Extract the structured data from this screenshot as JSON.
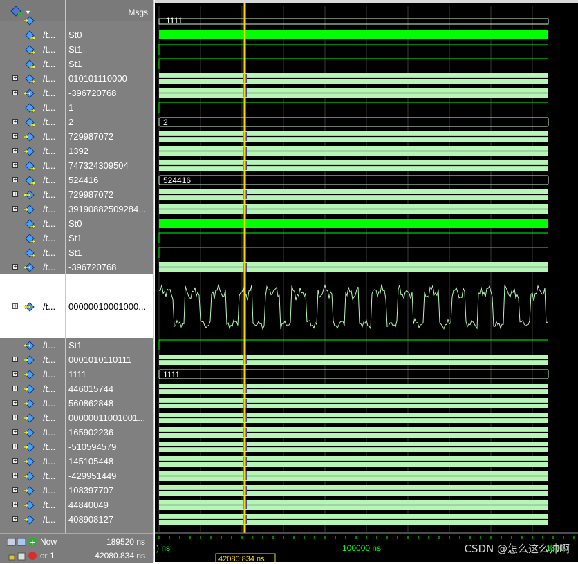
{
  "header": {
    "msgs_label": "Msgs",
    "top_icon": "wave-window-icon"
  },
  "signals": [
    {
      "name": "/t...",
      "value": "St0",
      "expandable": false,
      "kind": "bit",
      "level": "St0",
      "icon": "input-port-icon"
    },
    {
      "name": "/t...",
      "value": "St1",
      "expandable": false,
      "kind": "bit",
      "level": "St1",
      "icon": "input-port-icon"
    },
    {
      "name": "/t...",
      "value": "St1",
      "expandable": false,
      "kind": "bit",
      "level": "St1",
      "icon": "input-port-icon"
    },
    {
      "name": "/t...",
      "value": "010101110000",
      "expandable": true,
      "kind": "bus",
      "icon": "input-port-icon"
    },
    {
      "name": "/t...",
      "value": "-396720768",
      "expandable": true,
      "kind": "bus",
      "icon": "inout-port-icon"
    },
    {
      "name": "/t...",
      "value": "1",
      "expandable": false,
      "kind": "bit",
      "level": "St1",
      "icon": "input-port-icon"
    },
    {
      "name": "/t...",
      "value": "2",
      "expandable": true,
      "kind": "bus-const",
      "label": "2",
      "icon": "input-port-icon"
    },
    {
      "name": "/t...",
      "value": "729987072",
      "expandable": true,
      "kind": "bus",
      "icon": "output-port-icon"
    },
    {
      "name": "/t...",
      "value": "1392",
      "expandable": true,
      "kind": "bus",
      "icon": "output-port-icon"
    },
    {
      "name": "/t...",
      "value": "747324309504",
      "expandable": true,
      "kind": "bus",
      "icon": "input-port-icon"
    },
    {
      "name": "/t...",
      "value": "524416",
      "expandable": true,
      "kind": "bus-const",
      "label": "524416",
      "icon": "input-port-icon"
    },
    {
      "name": "/t...",
      "value": "729987072",
      "expandable": true,
      "kind": "bus",
      "icon": "inout-port-icon"
    },
    {
      "name": "/t...",
      "value": "39190882509284...",
      "expandable": true,
      "kind": "bus",
      "icon": "output-port-icon"
    },
    {
      "name": "/t...",
      "value": "St0",
      "expandable": false,
      "kind": "bit",
      "level": "St0",
      "icon": "input-port-icon"
    },
    {
      "name": "/t...",
      "value": "St1",
      "expandable": false,
      "kind": "bit",
      "level": "St1",
      "icon": "input-port-icon"
    },
    {
      "name": "/t...",
      "value": "St1",
      "expandable": false,
      "kind": "bit",
      "level": "St1",
      "icon": "input-port-icon"
    },
    {
      "name": "/t...",
      "value": "-396720768",
      "expandable": true,
      "kind": "bus",
      "icon": "inout-port-icon"
    },
    {
      "name": "/t...",
      "value": "00000010001000...",
      "expandable": true,
      "kind": "analog",
      "selected": true,
      "icon": "inout-port-icon"
    },
    {
      "name": "/t...",
      "value": "St1",
      "expandable": false,
      "kind": "bit",
      "level": "St1",
      "icon": "inout-port-icon"
    },
    {
      "name": "/t...",
      "value": "0001010110111",
      "expandable": true,
      "kind": "bus",
      "icon": "output-port-icon"
    },
    {
      "name": "/t...",
      "value": "1111",
      "expandable": true,
      "kind": "bus-const",
      "label": "1111",
      "icon": "output-port-icon"
    },
    {
      "name": "/t...",
      "value": "446015744",
      "expandable": true,
      "kind": "bus",
      "icon": "output-port-icon"
    },
    {
      "name": "/t...",
      "value": "560862848",
      "expandable": true,
      "kind": "bus",
      "icon": "output-port-icon"
    },
    {
      "name": "/t...",
      "value": "00000011001001...",
      "expandable": true,
      "kind": "bus",
      "icon": "output-port-icon"
    },
    {
      "name": "/t...",
      "value": "165902236",
      "expandable": true,
      "kind": "bus",
      "icon": "output-port-icon"
    },
    {
      "name": "/t...",
      "value": "-510594579",
      "expandable": true,
      "kind": "bus",
      "icon": "output-port-icon"
    },
    {
      "name": "/t...",
      "value": "145105448",
      "expandable": true,
      "kind": "bus",
      "icon": "output-port-icon"
    },
    {
      "name": "/t...",
      "value": "-429951449",
      "expandable": true,
      "kind": "bus",
      "icon": "output-port-icon"
    },
    {
      "name": "/t...",
      "value": "108397707",
      "expandable": true,
      "kind": "bus",
      "icon": "output-port-icon"
    },
    {
      "name": "/t...",
      "value": "44840049",
      "expandable": true,
      "kind": "bus",
      "icon": "output-port-icon"
    },
    {
      "name": "/t...",
      "value": "408908127",
      "expandable": true,
      "kind": "bus",
      "icon": "output-port-icon"
    }
  ],
  "partial_top": {
    "value": "1111"
  },
  "footer": {
    "now_label": "Now",
    "now_value": "189520 ns",
    "cursor_label": "or 1",
    "cursor_value": "42080.834 ns",
    "cursor_tag": "42080.834 ns",
    "icons": [
      "layout-icon",
      "zoom-icon",
      "add-icon",
      "lock-icon",
      "edit-icon",
      "remove-icon"
    ]
  },
  "timeline": {
    "left_label": ") ns",
    "mid_label": "100000 ns",
    "right_label": "1800"
  },
  "cursor_time_ns": 42080.834,
  "colors": {
    "wave_green": "#00ff00",
    "bus_green": "#b5f5b5",
    "cursor_yellow": "#ffd700",
    "background": "#000000",
    "panel_gray": "#808080"
  },
  "watermark": "CSDN @怎么这么帅啊"
}
